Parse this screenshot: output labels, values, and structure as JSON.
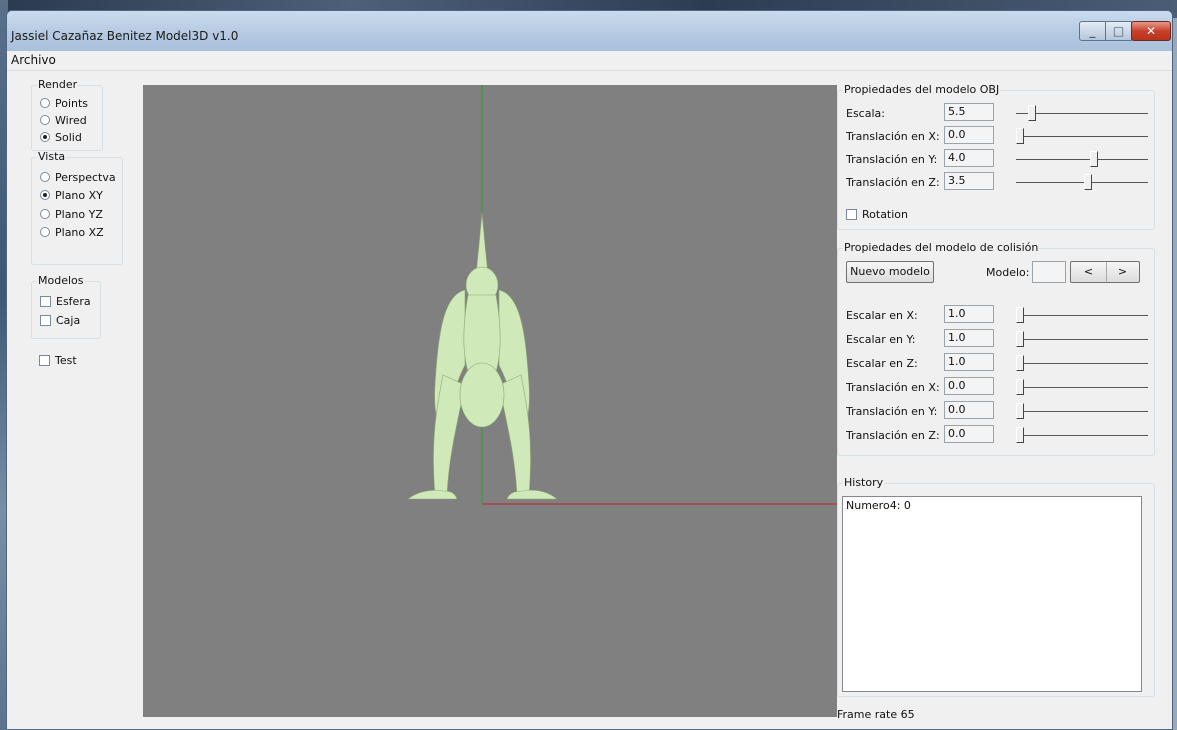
{
  "window": {
    "title": "Jassiel Cazañaz Benitez Model3D v1.0"
  },
  "menu": {
    "archivo": "Archivo"
  },
  "render": {
    "legend": "Render",
    "options": [
      "Points",
      "Wired",
      "Solid"
    ],
    "selected": "Solid"
  },
  "vista": {
    "legend": "Vista",
    "options": [
      "Perspectva",
      "Plano XY",
      "Plano YZ",
      "Plano XZ"
    ],
    "selected": "Plano XY"
  },
  "modelos": {
    "legend": "Modelos",
    "esfera": "Esfera",
    "caja": "Caja"
  },
  "test": {
    "label": "Test"
  },
  "obj_props": {
    "legend": "Propiedades del modelo OBJ",
    "rows": [
      {
        "label": "Escala:",
        "value": "5.5",
        "level": 0.1
      },
      {
        "label": "Translación en X:",
        "value": "0.0",
        "level": 0.0
      },
      {
        "label": "Translación en Y:",
        "value": "4.0",
        "level": 0.6
      },
      {
        "label": "Translación en Z:",
        "value": "3.5",
        "level": 0.55
      }
    ],
    "rotation": "Rotation"
  },
  "col_props": {
    "legend": "Propiedades del modelo de colisión",
    "nuevo_modelo": "Nuevo modelo",
    "modelo_label": "Modelo:",
    "modelo_value": "",
    "prev": "<",
    "next": ">",
    "rows": [
      {
        "label": "Escalar en X:",
        "value": "1.0",
        "level": 0.0
      },
      {
        "label": "Escalar en Y:",
        "value": "1.0",
        "level": 0.0
      },
      {
        "label": "Escalar en Z:",
        "value": "1.0",
        "level": 0.0
      },
      {
        "label": "Translación en X:",
        "value": "0.0",
        "level": 0.0
      },
      {
        "label": "Translación en Y:",
        "value": "0.0",
        "level": 0.0
      },
      {
        "label": "Translación en Z:",
        "value": "0.0",
        "level": 0.0
      }
    ]
  },
  "history": {
    "legend": "History",
    "entries": [
      "Numero4: 0"
    ]
  },
  "status": {
    "frame_rate": "Frame rate 65"
  },
  "colors": {
    "viewport_bg": "#808080",
    "model_fill": "#cfe9b8",
    "y_axis": "#2aa02a",
    "x_axis": "#c02020"
  }
}
